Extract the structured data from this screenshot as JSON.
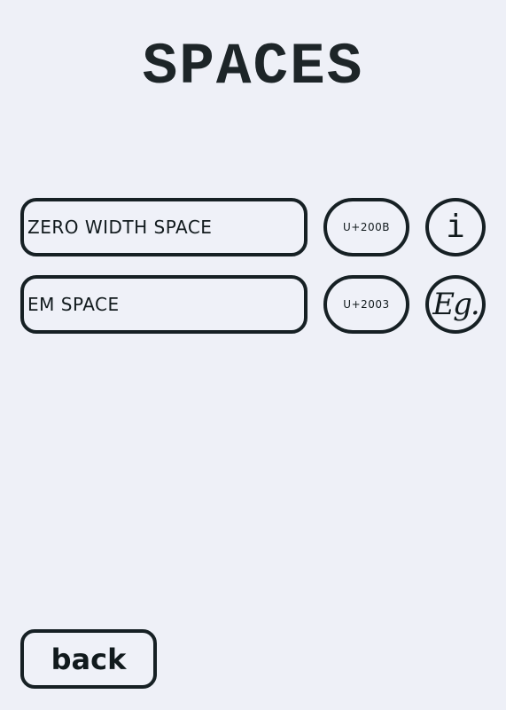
{
  "page": {
    "title": "SPACES",
    "background_color": "#eef0f7",
    "border_color": "#162024"
  },
  "spaces": [
    {
      "name": "ZERO WIDTH SPACE",
      "code": "U+200B",
      "action_label": "i",
      "action_icon": "info-icon"
    },
    {
      "name": "EM SPACE",
      "code": "U+2003",
      "action_label": "Eg.",
      "action_icon": "example-icon"
    }
  ],
  "footer": {
    "back_label": "back"
  }
}
